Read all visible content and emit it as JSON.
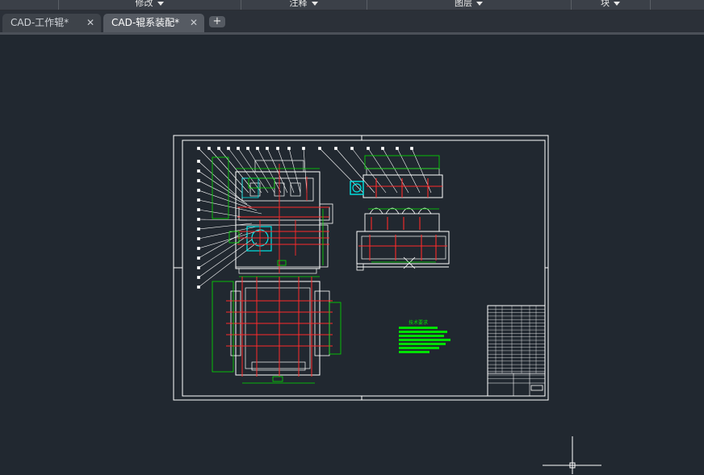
{
  "ribbon": {
    "groups": [
      {
        "label": "修改"
      },
      {
        "label": "注释"
      },
      {
        "label": "图层"
      },
      {
        "label": "块"
      }
    ]
  },
  "tabs": [
    {
      "label": "CAD-工作辊*",
      "close_label": "✕",
      "active": false
    },
    {
      "label": "CAD-辊系装配*",
      "close_label": "✕",
      "active": true
    }
  ],
  "new_tab_label": "+",
  "drawing": {
    "note_title": "技术要求"
  },
  "colors": {
    "background": "#212830",
    "outline": "#ffffff",
    "dimension": "#00e000",
    "centerline": "#ff2a2a",
    "highlight": "#00e6e6"
  }
}
